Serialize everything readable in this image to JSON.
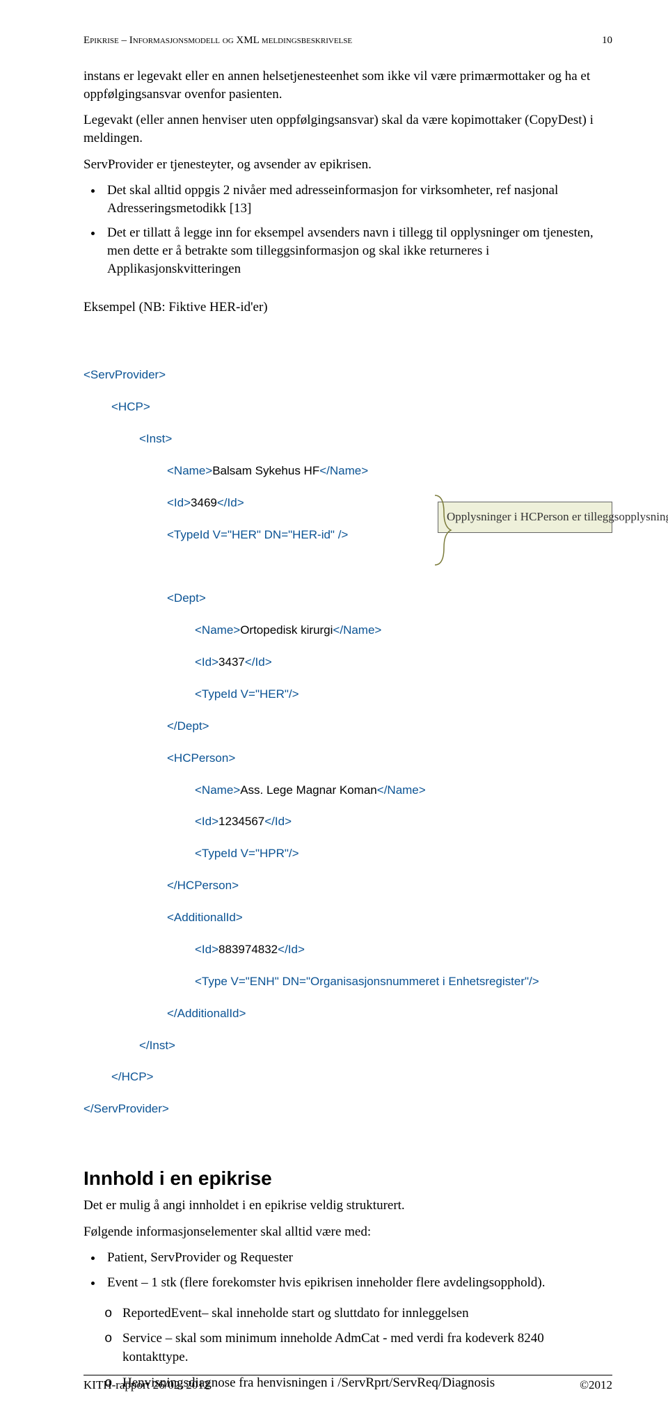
{
  "header": {
    "left": "Epikrise – Informasjonsmodell og XML meldingsbeskrivelse",
    "right": "10"
  },
  "para1": "instans er legevakt eller en annen helsetjenesteenhet som ikke vil være primærmottaker og ha et oppfølgingsansvar ovenfor pasienten.",
  "para2": "Legevakt (eller annen henviser uten oppfølgingsansvar) skal da være kopimottaker (CopyDest) i meldingen.",
  "para3": "ServProvider er tjenesteyter, og avsender av epikrisen.",
  "bullets": [
    "Det skal alltid oppgis 2 nivåer med adresseinformasjon for virksomheter, ref nasjonal Adresseringsmetodikk [13]",
    "Det er tillatt å legge inn for eksempel avsenders navn i tillegg til opplysninger om tjenesten, men dette er å betrakte som tilleggsinformasjon og skal ikke returneres i Applikasjonskvitteringen"
  ],
  "exampleHeading": "Eksempel (NB: Fiktive HER-id'er)",
  "xml": {
    "l1": "<ServProvider>",
    "l2": "<HCP>",
    "l3": "<Inst>",
    "l4a": "<Name>",
    "l4b": "Balsam Sykehus HF",
    "l4c": "</Name>",
    "l5a": "<Id>",
    "l5b": "3469",
    "l5c": "</Id>",
    "l6": "<TypeId V=\"HER\" DN=\"HER-id\" />",
    "l7": "<Dept>",
    "l8a": "<Name>",
    "l8b": "Ortopedisk kirurgi",
    "l8c": "</Name>",
    "l9a": "<Id>",
    "l9b": "3437",
    "l9c": "</Id>",
    "l10": "<TypeId V=\"HER\"/>",
    "l11": "</Dept>",
    "l12": "<HCPerson>",
    "l13a": "<Name>",
    "l13b": "Ass. Lege Magnar Koman",
    "l13c": "</Name>",
    "l14a": "<Id>",
    "l14b": "1234567",
    "l14c": "</Id>",
    "l15": "<TypeId V=\"HPR\"/>",
    "l16": "</HCPerson>",
    "l17": "<AdditionalId>",
    "l18a": "<Id>",
    "l18b": "883974832",
    "l18c": "</Id>",
    "l19": "<Type V=\"ENH\" DN=\"Organisasjonsnummeret i Enhetsregister\"/>",
    "l20": "</AdditionalId>",
    "l21": "</Inst>",
    "l22": "</HCP>",
    "l23": "</ServProvider>"
  },
  "callout": "Opplysninger i HCPerson er tilleggsopplysning som ikke skal returneres i",
  "section": "Innhold i en epikrise",
  "sectionPara1": "Det er mulig å angi innholdet i en epikrise veldig strukturert.",
  "sectionPara2": "Følgende informasjonselementer skal alltid være med:",
  "sectionBullets": [
    "Patient, ServProvider og Requester",
    "Event – 1 stk (flere forekomster hvis epikrisen inneholder flere avdelingsopphold)."
  ],
  "subBullets": [
    "ReportedEvent– skal inneholde start og sluttdato for innleggelsen",
    "Service – skal som minimum inneholde AdmCat - med verdi fra kodeverk 8240 kontakttype.",
    "Henvisningsdiagnose fra henvisningen i /ServRprt/ServReq/Diagnosis"
  ],
  "footer": {
    "left": "KITH-rapport 26/02: 2012",
    "right": "©2012"
  }
}
